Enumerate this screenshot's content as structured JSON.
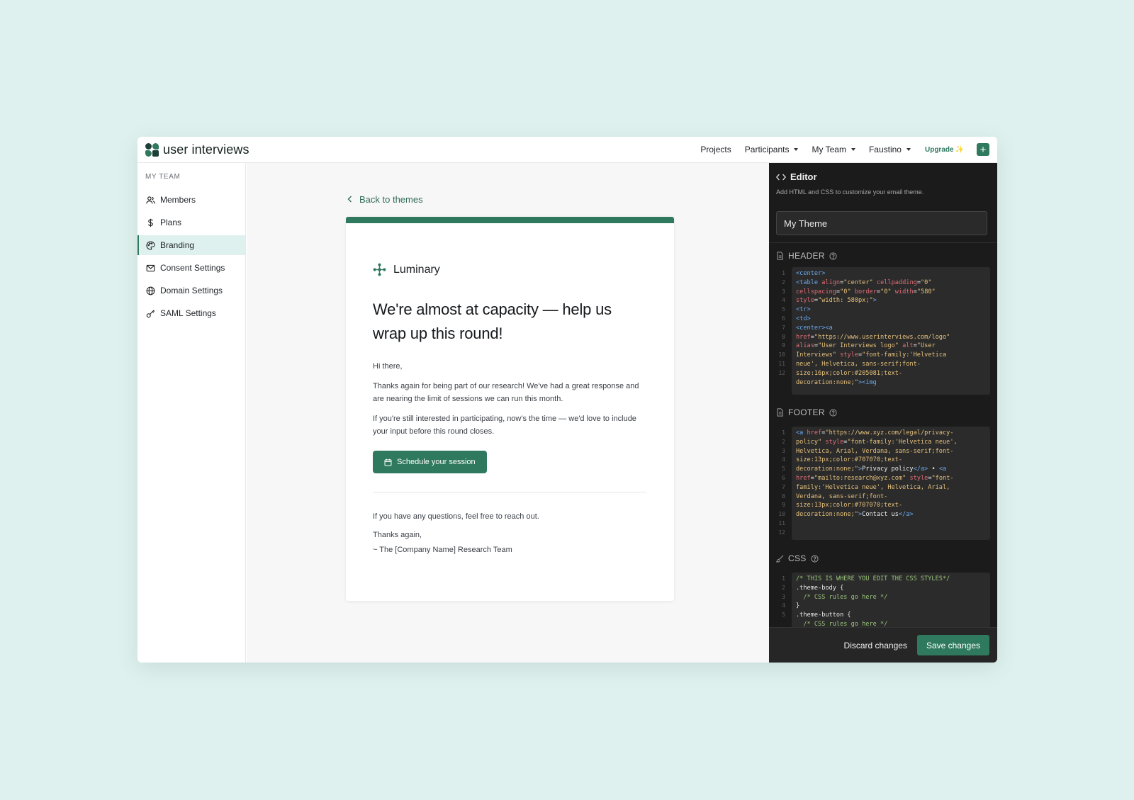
{
  "app": {
    "brand": "user interviews"
  },
  "nav": {
    "items": [
      {
        "label": "Projects",
        "dropdown": false
      },
      {
        "label": "Participants",
        "dropdown": true
      },
      {
        "label": "My Team",
        "dropdown": true
      },
      {
        "label": "Faustino",
        "dropdown": true
      }
    ],
    "upgrade": "Upgrade",
    "upgrade_icon": "✨",
    "add": "+"
  },
  "sidebar": {
    "heading": "MY TEAM",
    "items": [
      {
        "label": "Members",
        "icon": "users-icon"
      },
      {
        "label": "Plans",
        "icon": "dollar-icon"
      },
      {
        "label": "Branding",
        "icon": "palette-icon",
        "active": true
      },
      {
        "label": "Consent Settings",
        "icon": "mail-icon"
      },
      {
        "label": "Domain Settings",
        "icon": "globe-icon"
      },
      {
        "label": "SAML Settings",
        "icon": "key-icon"
      }
    ]
  },
  "preview": {
    "back": "Back to themes",
    "logo_name": "Luminary",
    "title": "We're almost at capacity — help us wrap up this round!",
    "greeting": "Hi there,",
    "para1": "Thanks again for being part of our research! We've had a great response and are nearing the limit of sessions we can run this month.",
    "para2": "If you're still interested in participating, now's the time — we'd love to include your input before this round closes.",
    "cta": "Schedule your session",
    "closing1": "If you have any questions, feel free to reach out.",
    "closing2": "Thanks again,",
    "closing3": "~ The [Company Name] Research Team"
  },
  "editor": {
    "title": "Editor",
    "subtitle": "Add HTML and CSS to customize your email theme.",
    "theme_name": "My Theme",
    "header_label": "HEADER",
    "footer_label": "FOOTER",
    "css_label": "CSS",
    "header_line_numbers": "1\n2\n3\n4\n5\n6\n7\n8\n9\n10\n11\n12",
    "footer_line_numbers": "1\n2\n3\n4\n5\n6\n7\n8\n9\n10\n11\n12",
    "css_line_numbers": "1\n2\n3\n4\n5",
    "discard": "Discard changes",
    "save": "Save changes"
  },
  "colors": {
    "accent": "#2f7a5f",
    "page_bg": "#dff1ee",
    "editor_bg": "#1b1b1b"
  }
}
